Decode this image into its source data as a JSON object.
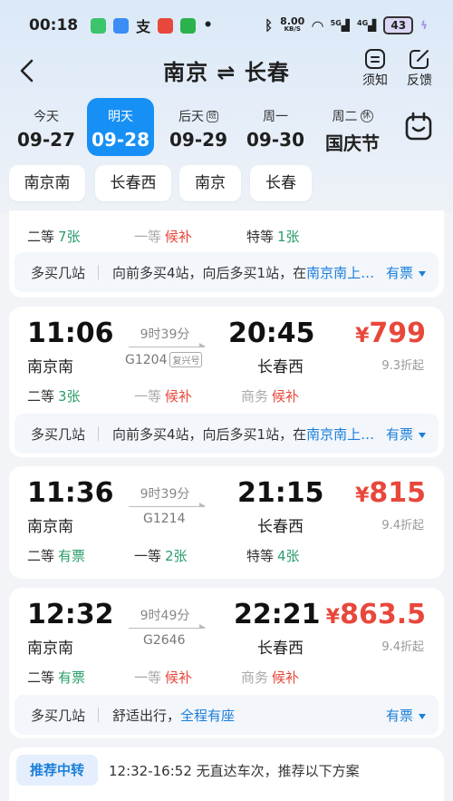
{
  "status_bar": {
    "time": "00:18",
    "net_speed_value": "8.00",
    "net_speed_unit": "KB/S",
    "signal1": "5G",
    "signal2": "4G",
    "battery": "43"
  },
  "header": {
    "title": "南京 ⇌ 长春",
    "actions": [
      {
        "label": "须知",
        "icon": "notice-icon"
      },
      {
        "label": "反馈",
        "icon": "feedback-icon"
      }
    ]
  },
  "dates": [
    {
      "label": "今天",
      "date": "09-27",
      "tag": ""
    },
    {
      "label": "明天",
      "date": "09-28",
      "tag": "",
      "selected": true
    },
    {
      "label": "后天",
      "date": "09-29",
      "tag": "班"
    },
    {
      "label": "周一",
      "date": "09-30",
      "tag": ""
    },
    {
      "label": "周二",
      "date": "国庆节",
      "tag": "休"
    }
  ],
  "stations": [
    "南京南",
    "长春西",
    "南京",
    "长春"
  ],
  "partial_card": {
    "seats": [
      {
        "class": "二等",
        "value": "7张",
        "status": "count",
        "dim": false
      },
      {
        "class": "一等",
        "value": "候补",
        "status": "wait",
        "dim": true
      },
      {
        "class": "特等",
        "value": "1张",
        "status": "count",
        "dim": false
      }
    ],
    "strip": {
      "label": "多买几站",
      "text": "向前多买4站，向后多买1站，在",
      "link": "南京南上…",
      "right": "有票"
    }
  },
  "trains": [
    {
      "dep_time": "11:06",
      "arr_time": "20:45",
      "duration": "9时39分",
      "train_no": "G1204",
      "badge": "复兴号",
      "from": "南京南",
      "to": "长春西",
      "price_symbol": "¥",
      "price": "799",
      "discount": "9.3折起",
      "seats": [
        {
          "class": "二等",
          "value": "3张",
          "status": "count",
          "dim": false
        },
        {
          "class": "一等",
          "value": "候补",
          "status": "wait",
          "dim": true
        },
        {
          "class": "商务",
          "value": "候补",
          "status": "wait",
          "dim": true
        }
      ],
      "strip": {
        "label": "多买几站",
        "text": "向前多买4站，向后多买1站，在",
        "link": "南京南上…",
        "right": "有票"
      }
    },
    {
      "dep_time": "11:36",
      "arr_time": "21:15",
      "duration": "9时39分",
      "train_no": "G1214",
      "badge": "",
      "from": "南京南",
      "to": "长春西",
      "price_symbol": "¥",
      "price": "815",
      "discount": "9.4折起",
      "seats": [
        {
          "class": "二等",
          "value": "有票",
          "status": "count",
          "dim": false
        },
        {
          "class": "一等",
          "value": "2张",
          "status": "count",
          "dim": false
        },
        {
          "class": "特等",
          "value": "4张",
          "status": "count",
          "dim": false
        }
      ]
    },
    {
      "dep_time": "12:32",
      "arr_time": "22:21",
      "duration": "9时49分",
      "train_no": "G2646",
      "badge": "",
      "from": "南京南",
      "to": "长春西",
      "price_symbol": "¥",
      "price": "863.5",
      "discount": "9.4折起",
      "seats": [
        {
          "class": "二等",
          "value": "有票",
          "status": "count",
          "dim": false
        },
        {
          "class": "一等",
          "value": "候补",
          "status": "wait",
          "dim": true
        },
        {
          "class": "商务",
          "value": "候补",
          "status": "wait",
          "dim": true
        }
      ],
      "strip": {
        "label": "多买几站",
        "text": "舒适出行，",
        "link": "全程有座",
        "right": "有票"
      }
    }
  ],
  "recommend": {
    "badge": "推荐中转",
    "text": "12:32-16:52 无直达车次，推荐以下方案"
  },
  "colors": {
    "accent": "#1790f5",
    "price": "#e8473b",
    "available": "#2a9d6a",
    "link": "#1b7fd9"
  }
}
